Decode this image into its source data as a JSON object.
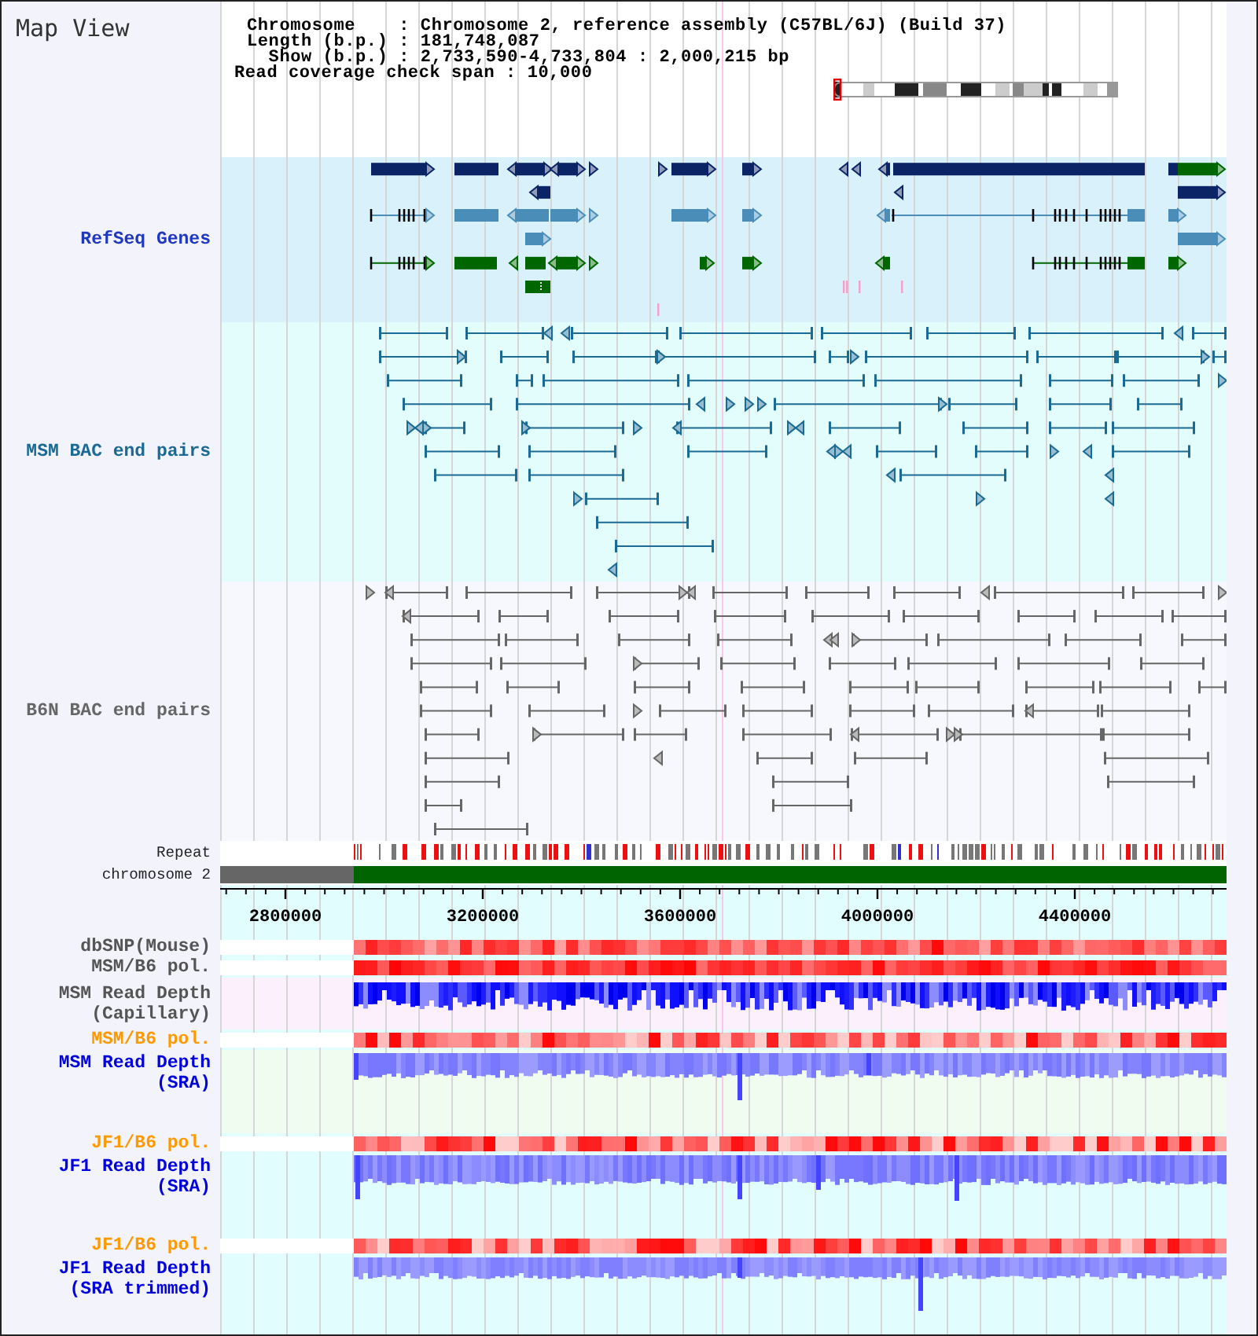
{
  "title": "Map View",
  "info": {
    "lines": [
      "Chromosome    : Chromosome 2, reference assembly (C57BL/6J) (Build 37)",
      "Length (b.p.) : 181,748,087",
      "  Show (b.p.) : 2,733,590-4,733,804 : 2,000,215 bp"
    ],
    "coverage_span": "Read coverage check span : 10,000"
  },
  "tracks": [
    {
      "kind": "genes",
      "label": "RefSeq Genes",
      "color": "#2038c0"
    },
    {
      "kind": "pairs",
      "label": "MSM BAC end pairs",
      "color": "#1a6a94"
    },
    {
      "kind": "pairs",
      "label": "B6N BAC end pairs",
      "color": "#666666"
    },
    {
      "kind": "repeat",
      "label": "Repeat"
    },
    {
      "kind": "chromosome",
      "label": "chromosome 2"
    },
    {
      "kind": "ruler",
      "ticks": [
        "2800000",
        "3200000",
        "3600000",
        "4000000",
        "4400000"
      ]
    },
    {
      "kind": "polymorphism",
      "label": "dbSNP(Mouse)",
      "color": "#555555"
    },
    {
      "kind": "polymorphism",
      "label": "MSM/B6 pol.",
      "color": "#555555"
    },
    {
      "kind": "depth",
      "label": "MSM Read Depth (Capillary)",
      "color": "#555555"
    },
    {
      "kind": "polymorphism",
      "label": "MSM/B6 pol.",
      "color": "#ff9900"
    },
    {
      "kind": "depth",
      "label": "MSM Read Depth (SRA)",
      "color": "#0000dd"
    },
    {
      "kind": "polymorphism",
      "label": "JF1/B6 pol.",
      "color": "#ff9900"
    },
    {
      "kind": "depth",
      "label": "JF1 Read Depth (SRA)",
      "color": "#0000dd"
    },
    {
      "kind": "polymorphism",
      "label": "JF1/B6 pol.",
      "color": "#ff9900"
    },
    {
      "kind": "depth",
      "label": "JF1 Read Depth (SRA trimmed)",
      "color": "#0000dd"
    }
  ]
}
